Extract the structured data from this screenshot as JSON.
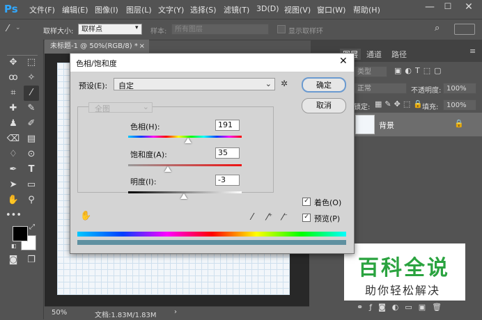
{
  "app": {
    "logo": "Ps"
  },
  "menu": [
    "文件(F)",
    "编辑(E)",
    "图像(I)",
    "图层(L)",
    "文字(Y)",
    "选择(S)",
    "滤镜(T)",
    "3D(D)",
    "视图(V)",
    "窗口(W)",
    "帮助(H)"
  ],
  "window_controls": {
    "minimize": "—",
    "maximize": "☐",
    "close": "✕"
  },
  "options": {
    "sample_size_label": "取样大小:",
    "sample_size_value": "取样点",
    "sample_label": "样本:",
    "sample_value": "所有图层",
    "show_ring_label": "显示取样环"
  },
  "document": {
    "tab_title": "未标题-1 @ 50%(RGB/8) *",
    "tab_close": "×",
    "zoom": "50%",
    "doc_info": "文档:1.83M/1.83M"
  },
  "panels": {
    "tabs": [
      "图层",
      "通道",
      "路径"
    ],
    "kind": "类型",
    "blend_mode": "正常",
    "opacity_label": "不透明度:",
    "opacity_value": "100%",
    "lock_label": "锁定:",
    "fill_label": "填充:",
    "fill_value": "100%",
    "layer_name": "背景"
  },
  "dialog": {
    "title": "色相/饱和度",
    "preset_label": "预设(E):",
    "preset_value": "自定",
    "channel_value": "全图",
    "ok_label": "确定",
    "cancel_label": "取消",
    "hue_label": "色相(H):",
    "hue_value": "191",
    "hue_fraction": 0.53,
    "saturation_label": "饱和度(A):",
    "saturation_value": "35",
    "saturation_fraction": 0.35,
    "lightness_label": "明度(I):",
    "lightness_value": "-3",
    "lightness_fraction": 0.49,
    "colorize_label": "着色(O)",
    "colorize_checked": true,
    "preview_label": "预览(P)",
    "preview_checked": true,
    "check_mark": "✓"
  },
  "watermark": {
    "title": "百科全说",
    "subtitle": "助你轻松解决",
    "title_color": "#2aa33f"
  },
  "colors": {
    "ps_blue": "#31a8ff",
    "foreground": "#000000",
    "background": "#ffffff"
  }
}
